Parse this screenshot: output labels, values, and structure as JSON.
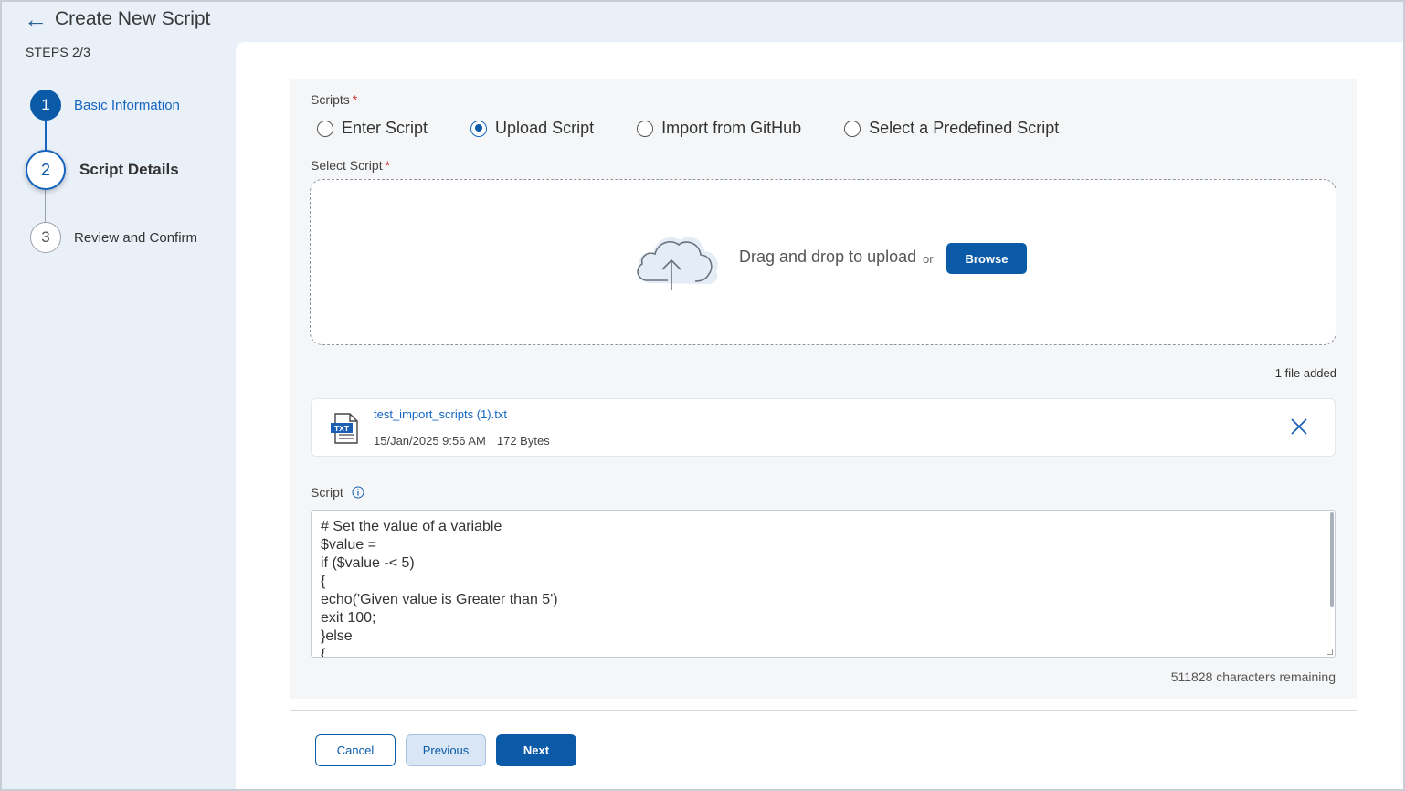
{
  "header": {
    "back_icon": "arrow-left-icon",
    "title": "Create New Script",
    "steps_count": "STEPS 2/3"
  },
  "stepper": {
    "steps": [
      {
        "number": "1",
        "label": "Basic Information",
        "state": "completed"
      },
      {
        "number": "2",
        "label": "Script Details",
        "state": "active"
      },
      {
        "number": "3",
        "label": "Review and Confirm",
        "state": "pending"
      }
    ]
  },
  "form": {
    "scripts_label": "Scripts",
    "required_mark": "*",
    "script_options": [
      {
        "label": "Enter Script",
        "selected": false
      },
      {
        "label": "Upload Script",
        "selected": true
      },
      {
        "label": "Import from GitHub",
        "selected": false
      },
      {
        "label": "Select a Predefined Script",
        "selected": false
      }
    ],
    "select_script_label": "Select Script",
    "dropzone": {
      "icon": "cloud-upload-icon",
      "text": "Drag and drop to upload",
      "or_text": "or",
      "browse_label": "Browse"
    },
    "files_added": "1 file added",
    "file": {
      "icon": "txt-file-icon",
      "icon_text": "TXT",
      "name": "test_import_scripts (1).txt",
      "date": "15/Jan/2025 9:56 AM",
      "size": "172 Bytes",
      "remove_icon": "close-icon"
    },
    "script_label": "Script",
    "script_info_icon": "info-icon",
    "script_lines": [
      "# Set the value of a variable",
      "$value =",
      "if ($value -< 5)",
      "{",
      "echo('Given value is Greater than 5')",
      "exit 100;",
      "}else",
      "{"
    ],
    "chars_remaining": "511828 characters remaining"
  },
  "footer": {
    "cancel_label": "Cancel",
    "previous_label": "Previous",
    "next_label": "Next"
  },
  "colors": {
    "primary": "#0a5aa8",
    "link": "#1565c0",
    "required": "#d32f2f",
    "background": "#eaf0f8"
  }
}
